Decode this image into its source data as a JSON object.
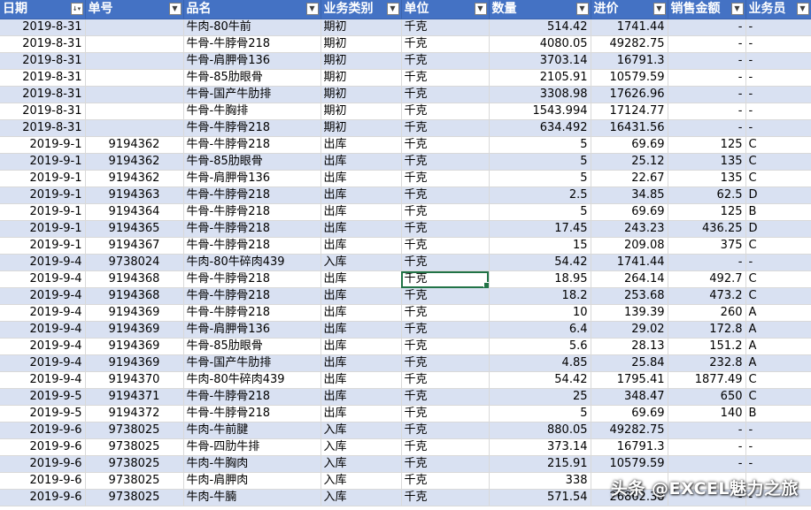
{
  "headers": [
    "日期",
    "单号",
    "品名",
    "业务类别",
    "单位",
    "数量",
    "进价",
    "销售金额",
    "业务员"
  ],
  "date_filter_icon": "sort-filter-icon",
  "filter_icon": "dropdown-arrow-icon",
  "rows": [
    [
      "2019-8-31",
      "",
      "牛肉-80牛前",
      "期初",
      "千克",
      "514.42",
      "1741.44",
      "-",
      "-"
    ],
    [
      "2019-8-31",
      "",
      "牛骨-牛脖骨218",
      "期初",
      "千克",
      "4080.05",
      "49282.75",
      "-",
      "-"
    ],
    [
      "2019-8-31",
      "",
      "牛骨-肩胛骨136",
      "期初",
      "千克",
      "3703.14",
      "16791.3",
      "-",
      "-"
    ],
    [
      "2019-8-31",
      "",
      "牛骨-85肋眼骨",
      "期初",
      "千克",
      "2105.91",
      "10579.59",
      "-",
      "-"
    ],
    [
      "2019-8-31",
      "",
      "牛骨-国产牛肋排",
      "期初",
      "千克",
      "3308.98",
      "17626.96",
      "-",
      "-"
    ],
    [
      "2019-8-31",
      "",
      "牛骨-牛胸排",
      "期初",
      "千克",
      "1543.994",
      "17124.77",
      "-",
      "-"
    ],
    [
      "2019-8-31",
      "",
      "牛骨-牛脖骨218",
      "期初",
      "千克",
      "634.492",
      "16431.56",
      "-",
      "-"
    ],
    [
      "2019-9-1",
      "9194362",
      "牛骨-牛脖骨218",
      "出库",
      "千克",
      "5",
      "69.69",
      "125",
      "C"
    ],
    [
      "2019-9-1",
      "9194362",
      "牛骨-85肋眼骨",
      "出库",
      "千克",
      "5",
      "25.12",
      "135",
      "C"
    ],
    [
      "2019-9-1",
      "9194362",
      "牛骨-肩胛骨136",
      "出库",
      "千克",
      "5",
      "22.67",
      "135",
      "C"
    ],
    [
      "2019-9-1",
      "9194363",
      "牛骨-牛脖骨218",
      "出库",
      "千克",
      "2.5",
      "34.85",
      "62.5",
      "D"
    ],
    [
      "2019-9-1",
      "9194364",
      "牛骨-牛脖骨218",
      "出库",
      "千克",
      "5",
      "69.69",
      "125",
      "B"
    ],
    [
      "2019-9-1",
      "9194365",
      "牛骨-牛脖骨218",
      "出库",
      "千克",
      "17.45",
      "243.23",
      "436.25",
      "D"
    ],
    [
      "2019-9-1",
      "9194367",
      "牛骨-牛脖骨218",
      "出库",
      "千克",
      "15",
      "209.08",
      "375",
      "C"
    ],
    [
      "2019-9-4",
      "9738024",
      "牛肉-80牛碎肉439",
      "入库",
      "千克",
      "54.42",
      "1741.44",
      "-",
      "-"
    ],
    [
      "2019-9-4",
      "9194368",
      "牛骨-牛脖骨218",
      "出库",
      "千克",
      "18.95",
      "264.14",
      "492.7",
      "C"
    ],
    [
      "2019-9-4",
      "9194368",
      "牛骨-牛脖骨218",
      "出库",
      "千克",
      "18.2",
      "253.68",
      "473.2",
      "C"
    ],
    [
      "2019-9-4",
      "9194369",
      "牛骨-牛脖骨218",
      "出库",
      "千克",
      "10",
      "139.39",
      "260",
      "A"
    ],
    [
      "2019-9-4",
      "9194369",
      "牛骨-肩胛骨136",
      "出库",
      "千克",
      "6.4",
      "29.02",
      "172.8",
      "A"
    ],
    [
      "2019-9-4",
      "9194369",
      "牛骨-85肋眼骨",
      "出库",
      "千克",
      "5.6",
      "28.13",
      "151.2",
      "A"
    ],
    [
      "2019-9-4",
      "9194369",
      "牛骨-国产牛肋排",
      "出库",
      "千克",
      "4.85",
      "25.84",
      "232.8",
      "A"
    ],
    [
      "2019-9-4",
      "9194370",
      "牛肉-80牛碎肉439",
      "出库",
      "千克",
      "54.42",
      "1795.41",
      "1877.49",
      "C"
    ],
    [
      "2019-9-5",
      "9194371",
      "牛骨-牛脖骨218",
      "出库",
      "千克",
      "25",
      "348.47",
      "650",
      "C"
    ],
    [
      "2019-9-5",
      "9194372",
      "牛骨-牛脖骨218",
      "出库",
      "千克",
      "5",
      "69.69",
      "140",
      "B"
    ],
    [
      "2019-9-6",
      "9738025",
      "牛肉-牛前腱",
      "入库",
      "千克",
      "880.05",
      "49282.75",
      "-",
      "-"
    ],
    [
      "2019-9-6",
      "9738025",
      "牛骨-四肋牛排",
      "入库",
      "千克",
      "373.14",
      "16791.3",
      "-",
      "-"
    ],
    [
      "2019-9-6",
      "9738025",
      "牛肉-牛胸肉",
      "入库",
      "千克",
      "215.91",
      "10579.59",
      "-",
      "-"
    ],
    [
      "2019-9-6",
      "9738025",
      "牛肉-肩胛肉",
      "入库",
      "千克",
      "338",
      "",
      "",
      ""
    ],
    [
      "2019-9-6",
      "9738025",
      "牛肉-牛腩",
      "入库",
      "千克",
      "571.54",
      "26862.38",
      "-",
      "-"
    ]
  ],
  "watermark": "头条 @EXCEL魅力之旅"
}
